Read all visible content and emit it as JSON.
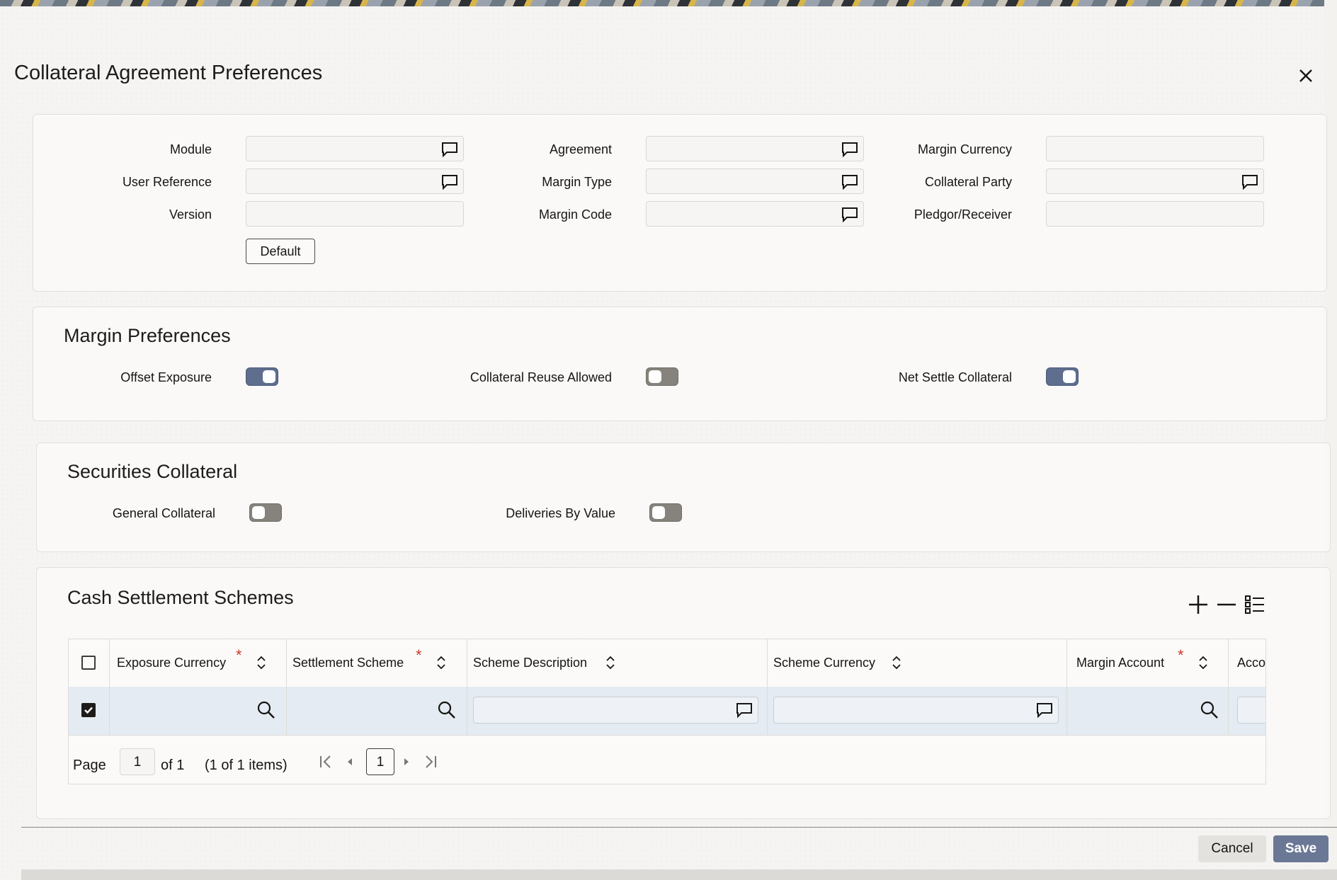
{
  "dialog": {
    "title": "Collateral Agreement Preferences",
    "close_icon": "close-icon"
  },
  "header_form": {
    "fields": [
      {
        "label": "Module",
        "value": "",
        "lov": true
      },
      {
        "label": "User Reference",
        "value": "",
        "lov": true
      },
      {
        "label": "Version",
        "value": "",
        "lov": false
      },
      {
        "label": "Agreement",
        "value": "",
        "lov": true
      },
      {
        "label": "Margin Type",
        "value": "",
        "lov": true
      },
      {
        "label": "Margin Code",
        "value": "",
        "lov": true
      },
      {
        "label": "Margin Currency",
        "value": "",
        "lov": false
      },
      {
        "label": "Collateral Party",
        "value": "",
        "lov": true
      },
      {
        "label": "Pledgor/Receiver",
        "value": "",
        "lov": false
      }
    ],
    "default_button": "Default"
  },
  "margin_preferences": {
    "title": "Margin Preferences",
    "toggles": [
      {
        "label": "Offset Exposure",
        "on": true
      },
      {
        "label": "Collateral Reuse Allowed",
        "on": false
      },
      {
        "label": "Net Settle Collateral",
        "on": true
      }
    ]
  },
  "securities_collateral": {
    "title": "Securities Collateral",
    "toggles": [
      {
        "label": "General Collateral",
        "on": false
      },
      {
        "label": "Deliveries By Value",
        "on": false
      }
    ]
  },
  "cash_settlement": {
    "title": "Cash Settlement Schemes",
    "toolbar": [
      "add-icon",
      "remove-icon",
      "single-record-view-icon"
    ],
    "columns": [
      {
        "label": "Exposure Currency",
        "required": true
      },
      {
        "label": "Settlement Scheme",
        "required": true
      },
      {
        "label": "Scheme Description",
        "required": false
      },
      {
        "label": "Scheme Currency",
        "required": false
      },
      {
        "label": "Margin Account",
        "required": true
      },
      {
        "label": "Accou",
        "required": false
      }
    ],
    "rows": [
      {
        "selected": true,
        "exposure_currency": "",
        "settlement_scheme": "",
        "scheme_description": "",
        "scheme_currency": "",
        "margin_account": ""
      }
    ],
    "pagination": {
      "page_label": "Page",
      "page_value": "1",
      "of_text": "of 1",
      "items_text": "(1 of 1 items)",
      "current_page": "1"
    }
  },
  "actions": {
    "cancel": "Cancel",
    "save": "Save"
  },
  "colors": {
    "toggle_on": "#5f6d8e",
    "toggle_off": "#86827c",
    "save_button": "#6b7895",
    "selected_row": "#e4ebf2",
    "required_marker": "#c73c2e"
  }
}
